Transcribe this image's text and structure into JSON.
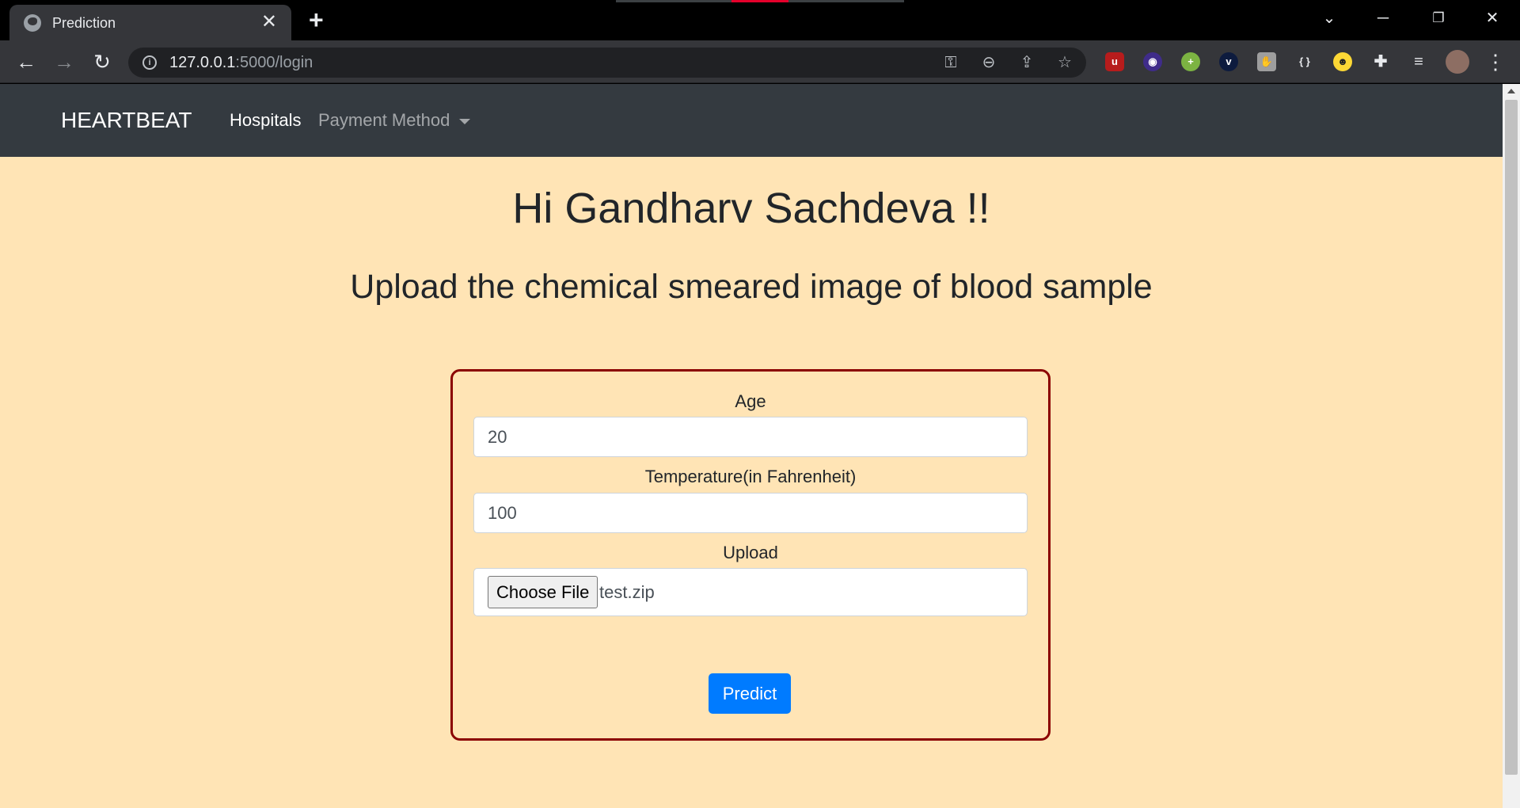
{
  "browser": {
    "tab_title": "Prediction",
    "tab_close": "✕",
    "new_tab": "+",
    "url_host": "127.0.0.1",
    "url_path": ":5000/login",
    "icons": [
      "back-icon",
      "forward-icon",
      "reload-icon",
      "info-icon",
      "key-icon",
      "zoom-out-icon",
      "share-icon",
      "bookmark-star-icon",
      "ublock-extension-icon",
      "eye-extension-icon",
      "plus-extension-icon",
      "v-extension-icon",
      "hand-extension-icon",
      "braces-extension-icon",
      "face-extension-icon",
      "puzzle-extensions-icon",
      "reading-list-icon",
      "profile-avatar",
      "menu-icon"
    ]
  },
  "navbar": {
    "brand": "HEARTBEAT",
    "links": [
      "Hospitals",
      "Payment Method"
    ]
  },
  "page": {
    "greeting": "Hi Gandharv Sachdeva !!",
    "subtitle": "Upload the chemical smeared image of blood sample"
  },
  "form": {
    "age_label": "Age",
    "age_value": "20",
    "temp_label": "Temperature(in Fahrenheit)",
    "temp_value": "100",
    "upload_label": "Upload",
    "choose_file_label": "Choose File",
    "file_name": "test.zip",
    "predict_label": "Predict"
  },
  "colors": {
    "page_bg": "#ffe4b5",
    "navbar_bg": "#343a40",
    "form_border": "#8b0000",
    "primary_button": "#007bff"
  }
}
